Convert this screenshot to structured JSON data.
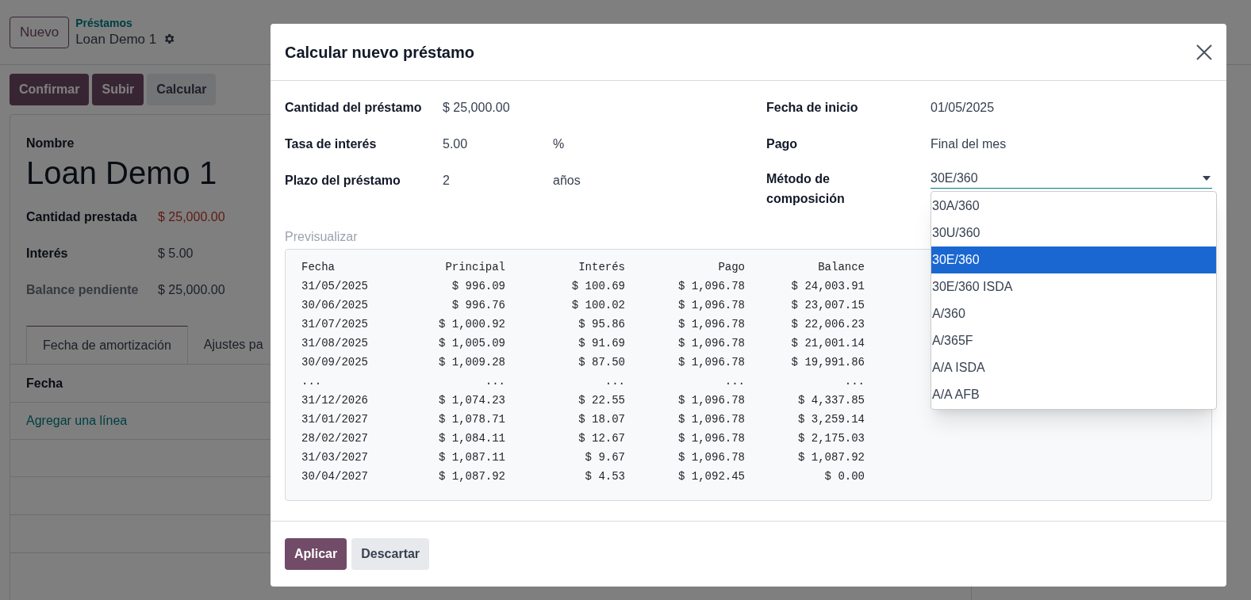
{
  "control_panel": {
    "new_button": "Nuevo",
    "breadcrumb": {
      "parent": "Préstamos",
      "current": "Loan Demo 1"
    },
    "actions": [
      {
        "label": "Confirmar",
        "kind": "primary"
      },
      {
        "label": "Subir",
        "kind": "primary"
      },
      {
        "label": "Calcular",
        "kind": "secondary"
      }
    ]
  },
  "record": {
    "name_label": "Nombre",
    "name": "Loan Demo 1",
    "fields": [
      {
        "label": "Cantidad prestada",
        "value": "$ 25,000.00",
        "kind": "negative"
      },
      {
        "label": "Interés",
        "value": "$ 5.00",
        "kind": "plain"
      },
      {
        "label": "Balance pendiente",
        "value": "$ 25,000.00",
        "kind": "muted"
      }
    ],
    "tabs": [
      {
        "label": "Fecha de amortización",
        "selected": true
      },
      {
        "label": "Ajustes pa",
        "selected": false
      }
    ],
    "table": {
      "columns": [
        "Fecha"
      ],
      "add_line": "Agregar una línea"
    }
  },
  "dialog": {
    "title": "Calcular nuevo préstamo",
    "left_fields": [
      {
        "label": "Cantidad del préstamo",
        "value": "$ 25,000.00"
      },
      {
        "label": "Tasa de interés",
        "value": "5.00",
        "unit": "%"
      },
      {
        "label": "Plazo del préstamo",
        "value": "2",
        "unit": "años"
      }
    ],
    "right_fields": [
      {
        "label": "Fecha de inicio",
        "value": "01/05/2025"
      },
      {
        "label": "Pago",
        "value": "Final del mes"
      }
    ],
    "method": {
      "label": "Método de composición",
      "value": "30E/360",
      "options": [
        {
          "label": "30A/360",
          "selected": false
        },
        {
          "label": "30U/360",
          "selected": false
        },
        {
          "label": "30E/360",
          "selected": true
        },
        {
          "label": "30E/360 ISDA",
          "selected": false
        },
        {
          "label": "A/360",
          "selected": false
        },
        {
          "label": "A/365F",
          "selected": false
        },
        {
          "label": "A/A ISDA",
          "selected": false
        },
        {
          "label": "A/A AFB",
          "selected": false
        }
      ]
    },
    "preview": {
      "label": "Previsualizar",
      "columns": [
        "Fecha",
        "Principal",
        "Interés",
        "Pago",
        "Balance"
      ],
      "rows": [
        [
          "31/05/2025",
          "$ 996.09",
          "$ 100.69",
          "$ 1,096.78",
          "$ 24,003.91"
        ],
        [
          "30/06/2025",
          "$ 996.76",
          "$ 100.02",
          "$ 1,096.78",
          "$ 23,007.15"
        ],
        [
          "31/07/2025",
          "$ 1,000.92",
          "$ 95.86",
          "$ 1,096.78",
          "$ 22,006.23"
        ],
        [
          "31/08/2025",
          "$ 1,005.09",
          "$ 91.69",
          "$ 1,096.78",
          "$ 21,001.14"
        ],
        [
          "30/09/2025",
          "$ 1,009.28",
          "$ 87.50",
          "$ 1,096.78",
          "$ 19,991.86"
        ],
        [
          "...",
          "...",
          "...",
          "...",
          "..."
        ],
        [
          "31/12/2026",
          "$ 1,074.23",
          "$ 22.55",
          "$ 1,096.78",
          "$ 4,337.85"
        ],
        [
          "31/01/2027",
          "$ 1,078.71",
          "$ 18.07",
          "$ 1,096.78",
          "$ 3,259.14"
        ],
        [
          "28/02/2027",
          "$ 1,084.11",
          "$ 12.67",
          "$ 1,096.78",
          "$ 2,175.03"
        ],
        [
          "31/03/2027",
          "$ 1,087.11",
          "$ 9.67",
          "$ 1,096.78",
          "$ 1,087.92"
        ],
        [
          "30/04/2027",
          "$ 1,087.92",
          "$ 4.53",
          "$ 1,092.45",
          "$ 0.00"
        ]
      ]
    },
    "buttons": [
      {
        "label": "Aplicar",
        "kind": "primary"
      },
      {
        "label": "Descartar",
        "kind": "secondary"
      }
    ]
  }
}
